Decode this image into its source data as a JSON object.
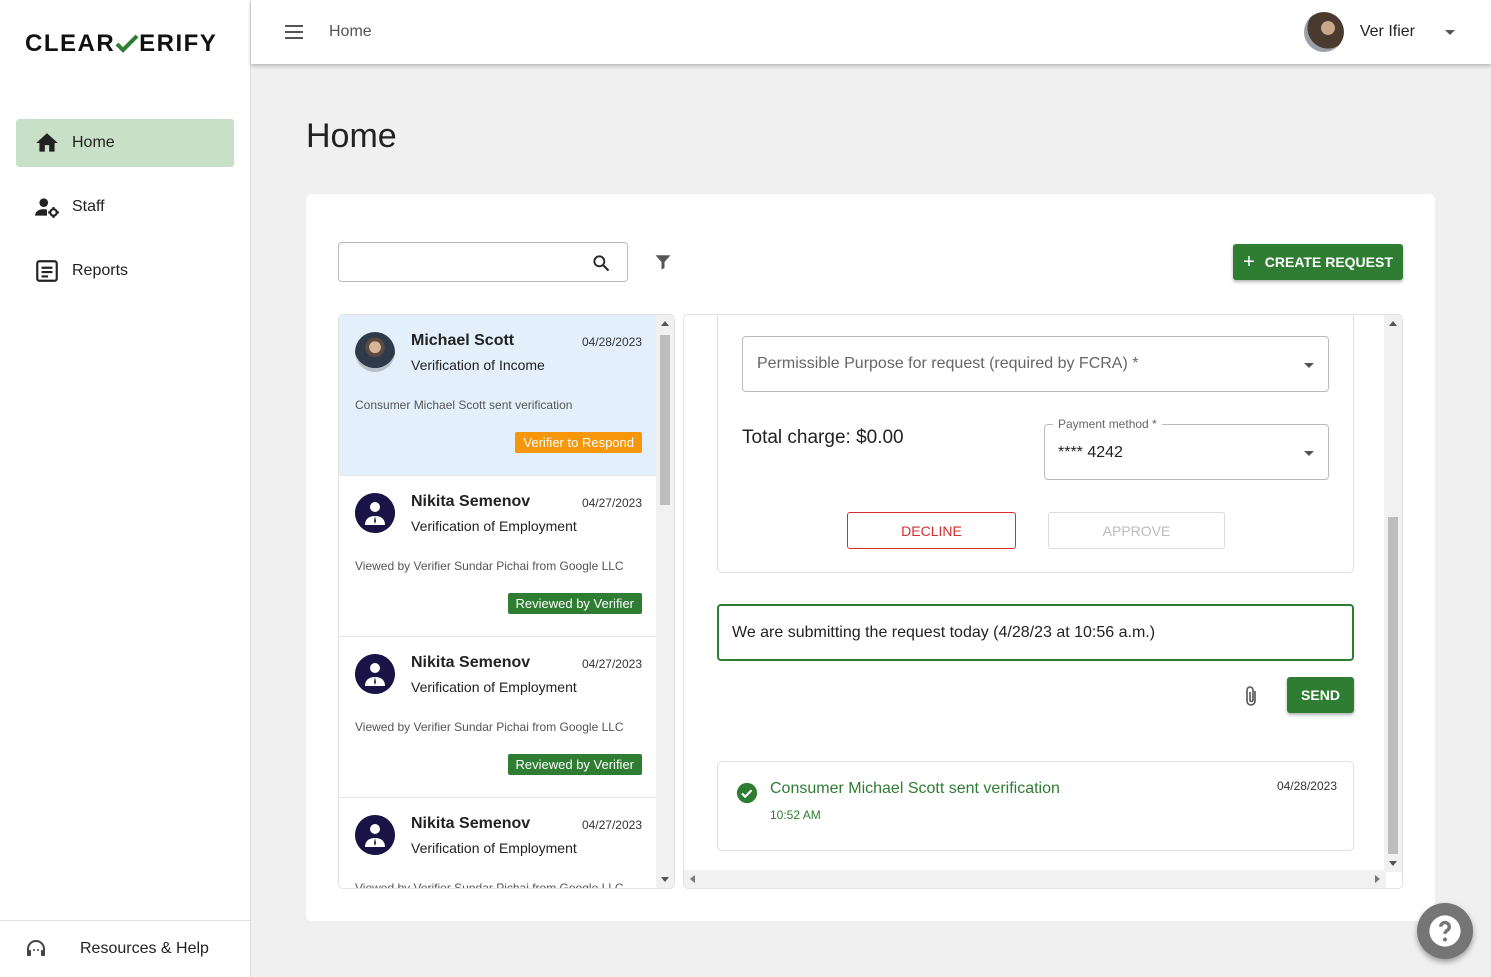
{
  "app": {
    "logo_left": "CLEAR",
    "logo_right": "ERIFY"
  },
  "sidebar": {
    "items": [
      {
        "label": "Home",
        "icon": "home-icon",
        "active": true
      },
      {
        "label": "Staff",
        "icon": "staff-icon"
      },
      {
        "label": "Reports",
        "icon": "reports-icon"
      }
    ],
    "help_label": "Resources & Help"
  },
  "topbar": {
    "breadcrumb": "Home",
    "user_name": "Ver Ifier"
  },
  "page": {
    "title": "Home"
  },
  "toolbar": {
    "search_placeholder": "",
    "create_label": "CREATE REQUEST"
  },
  "requests": [
    {
      "name": "Michael Scott",
      "date": "04/28/2023",
      "type": "Verification of Income",
      "note": "Consumer Michael Scott sent verification",
      "badge": "Verifier to Respond",
      "badge_color": "#f6960b"
    },
    {
      "name": "Nikita Semenov",
      "date": "04/27/2023",
      "type": "Verification of Employment",
      "note": "Viewed by Verifier Sundar Pichai from Google LLC",
      "badge": "Reviewed by Verifier",
      "badge_color": "#2e7d32"
    },
    {
      "name": "Nikita Semenov",
      "date": "04/27/2023",
      "type": "Verification of Employment",
      "note": "Viewed by Verifier Sundar Pichai from Google LLC",
      "badge": "Reviewed by Verifier",
      "badge_color": "#2e7d32"
    },
    {
      "name": "Nikita Semenov",
      "date": "04/27/2023",
      "type": "Verification of Employment",
      "note": "Viewed by Verifier Sundar Pichai from Google LLC",
      "badge": ""
    }
  ],
  "detail": {
    "purpose_placeholder": "Permissible Purpose for request (required by FCRA) *",
    "total_charge": "Total charge: $0.00",
    "payment_label": "Payment method *",
    "payment_value": "**** 4242",
    "decline_label": "DECLINE",
    "approve_label": "APPROVE",
    "message_text": "We are submitting the request today (4/28/23 at 10:56 a.m.)",
    "send_label": "SEND",
    "event": {
      "title": "Consumer Michael Scott sent verification",
      "time": "10:52 AM",
      "date": "04/28/2023"
    }
  },
  "colors": {
    "accent": "#2e7d32",
    "active_nav": "#c8e0c8",
    "selected_item": "#e3f0fc",
    "warning": "#f6960b",
    "danger": "#d32f2f"
  }
}
